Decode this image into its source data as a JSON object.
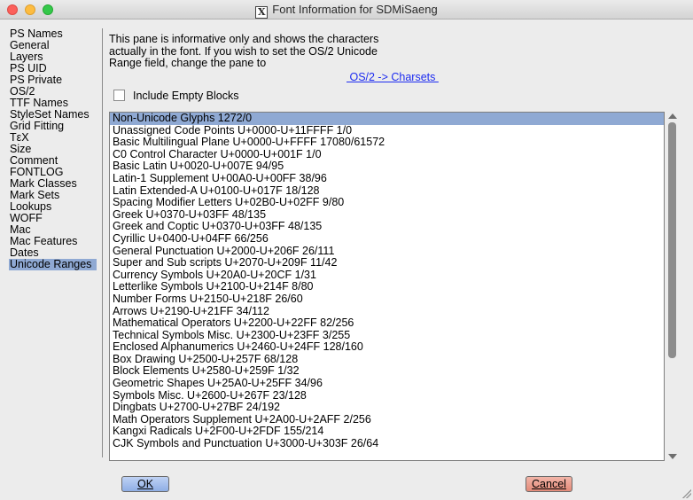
{
  "window": {
    "title": "Font Information for SDMiSaeng"
  },
  "sidebar": {
    "items": [
      {
        "label": "PS Names"
      },
      {
        "label": "General"
      },
      {
        "label": "Layers"
      },
      {
        "label": "PS UID"
      },
      {
        "label": "PS Private"
      },
      {
        "label": "OS/2"
      },
      {
        "label": "TTF Names"
      },
      {
        "label": "StyleSet Names"
      },
      {
        "label": "Grid Fitting"
      },
      {
        "label": "TεX"
      },
      {
        "label": "Size"
      },
      {
        "label": "Comment"
      },
      {
        "label": "FONTLOG"
      },
      {
        "label": "Mark Classes"
      },
      {
        "label": "Mark Sets"
      },
      {
        "label": "Lookups"
      },
      {
        "label": "WOFF"
      },
      {
        "label": "Mac"
      },
      {
        "label": "Mac Features"
      },
      {
        "label": "Dates"
      },
      {
        "label": "Unicode Ranges"
      }
    ],
    "selected": "Unicode Ranges"
  },
  "pane": {
    "info_text": "This pane is informative only and shows the characters actually in the font. If you wish to set the OS/2 Unicode Range field, change the pane to",
    "charset_link": " OS/2 -> Charsets ",
    "include_empty_label": "Include Empty Blocks",
    "include_empty_checked": false
  },
  "ranges": [
    "Non-Unicode Glyphs  1272/0",
    "Unassigned Code Points  U+0000-U+11FFFF 1/0",
    "Basic Multilingual Plane  U+0000-U+FFFF 17080/61572",
    "C0 Control Character  U+0000-U+001F 1/0",
    "Basic Latin  U+0020-U+007E 94/95",
    "Latin-1 Supplement  U+00A0-U+00FF 38/96",
    "Latin Extended-A  U+0100-U+017F 18/128",
    "Spacing Modifier Letters  U+02B0-U+02FF 9/80",
    "Greek  U+0370-U+03FF 48/135",
    "Greek and Coptic  U+0370-U+03FF 48/135",
    "Cyrillic  U+0400-U+04FF 66/256",
    "General Punctuation  U+2000-U+206F 26/111",
    "Super and Sub scripts  U+2070-U+209F 11/42",
    "Currency Symbols  U+20A0-U+20CF 1/31",
    "Letterlike Symbols  U+2100-U+214F 8/80",
    "Number Forms  U+2150-U+218F 26/60",
    "Arrows  U+2190-U+21FF 34/112",
    "Mathematical Operators  U+2200-U+22FF 82/256",
    "Technical Symbols Misc.  U+2300-U+23FF 3/255",
    "Enclosed Alphanumerics  U+2460-U+24FF 128/160",
    "Box Drawing  U+2500-U+257F 68/128",
    "Block Elements  U+2580-U+259F 1/32",
    "Geometric Shapes  U+25A0-U+25FF 34/96",
    "Symbols Misc.  U+2600-U+267F 23/128",
    "Dingbats  U+2700-U+27BF 24/192",
    "Math Operators Supplement  U+2A00-U+2AFF 2/256",
    "Kangxi Radicals  U+2F00-U+2FDF 155/214",
    "CJK Symbols and Punctuation  U+3000-U+303F 26/64"
  ],
  "selected_range_index": 0,
  "scrollbar": {
    "position_fraction": 0.0,
    "visible_fraction": 0.72
  },
  "buttons": {
    "ok": "OK",
    "cancel": "Cancel"
  },
  "colors": {
    "selection": "#8fa9d3",
    "link": "#1d2cf0",
    "ok_button": "#a9c2ef",
    "cancel_button": "#ea9c8b"
  }
}
